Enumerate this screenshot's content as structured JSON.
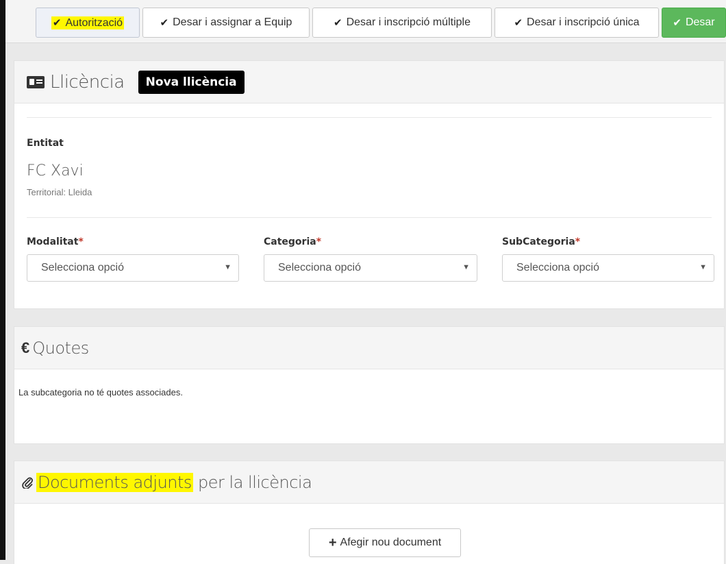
{
  "toolbar": {
    "buttons": [
      {
        "label": "Autorització",
        "highlighted": true
      },
      {
        "label": "Desar i assignar a Equip"
      },
      {
        "label": "Desar i inscripció múltiple"
      },
      {
        "label": "Desar i inscripció única"
      },
      {
        "label": "Desar",
        "style": "success"
      }
    ],
    "check_icon": "check-icon"
  },
  "licence": {
    "title": "Llicència",
    "badge": "Nova llicència",
    "icon": "id-card-icon",
    "entity_label": "Entitat",
    "entity_name": "FC Xavi",
    "territorial": "Territorial: Lleida",
    "fields": [
      {
        "label": "Modalitat",
        "required_mark": "*",
        "value": "Selecciona opció"
      },
      {
        "label": "Categoria",
        "required_mark": "*",
        "value": "Selecciona opció"
      },
      {
        "label": "SubCategoria",
        "required_mark": "*",
        "value": "Selecciona opció"
      }
    ],
    "caret": "▼"
  },
  "quotes": {
    "icon_glyph": "€",
    "title": "Quotes",
    "message": "La subcategoria no té quotes associades."
  },
  "documents": {
    "icon": "paperclip-icon",
    "title_highlighted": "Documents adjunts",
    "title_rest": " per la llicència",
    "add_label": "Afegir nou document"
  },
  "colors": {
    "highlight": "#fff700",
    "success": "#5cb85c",
    "required": "#c0392b"
  }
}
